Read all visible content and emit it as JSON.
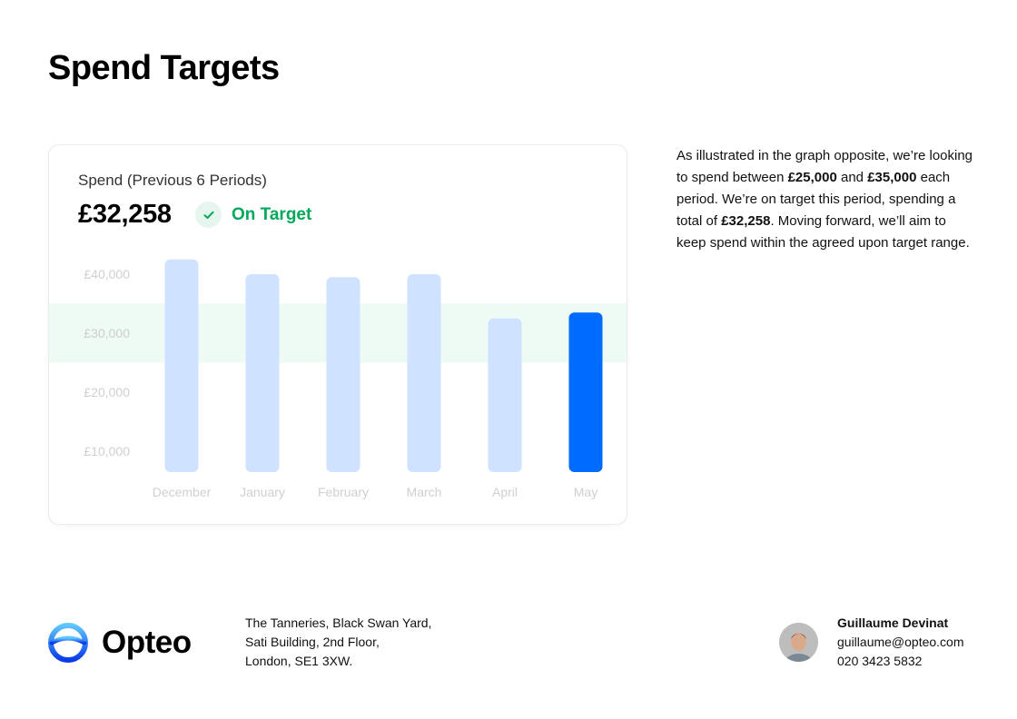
{
  "page": {
    "title": "Spend Targets"
  },
  "card": {
    "label": "Spend (Previous 6 Periods)",
    "value": "£32,258",
    "status": "On Target"
  },
  "chart_data": {
    "type": "bar",
    "categories": [
      "December",
      "January",
      "February",
      "March",
      "April",
      "May"
    ],
    "values": [
      42500,
      40000,
      39500,
      40000,
      32500,
      33500
    ],
    "highlight_index": 5,
    "yticks": [
      10000,
      20000,
      30000,
      40000
    ],
    "ytick_labels": [
      "£10,000",
      "£20,000",
      "£30,000",
      "£40,000"
    ],
    "target_range": [
      25000,
      35000
    ],
    "ylim": [
      5000,
      42500
    ],
    "colors": {
      "bar": "#cfe2ff",
      "bar_highlight": "#006bff",
      "target_band": "#eefaf4",
      "tick_text": "#cfcfcf"
    }
  },
  "description": {
    "p1": "As illustrated in the graph opposite, we’re looking to spend between ",
    "b1": "£25,000",
    "p2": " and ",
    "b2": "£35,000",
    "p3": " each period. We’re on target this period, spending a total of ",
    "b3": "£32,258",
    "p4": ". Moving forward, we’ll aim to keep spend within the agreed upon target range."
  },
  "footer": {
    "brand": "Opteo",
    "address": [
      "The Tanneries, Black Swan Yard,",
      "Sati Building, 2nd Floor,",
      "London, SE1 3XW."
    ],
    "contact": {
      "name": "Guillaume Devinat",
      "email": "guillaume@opteo.com",
      "phone": "020 3423 5832"
    }
  },
  "colors": {
    "accent": "#006bff",
    "success": "#00a85a"
  }
}
